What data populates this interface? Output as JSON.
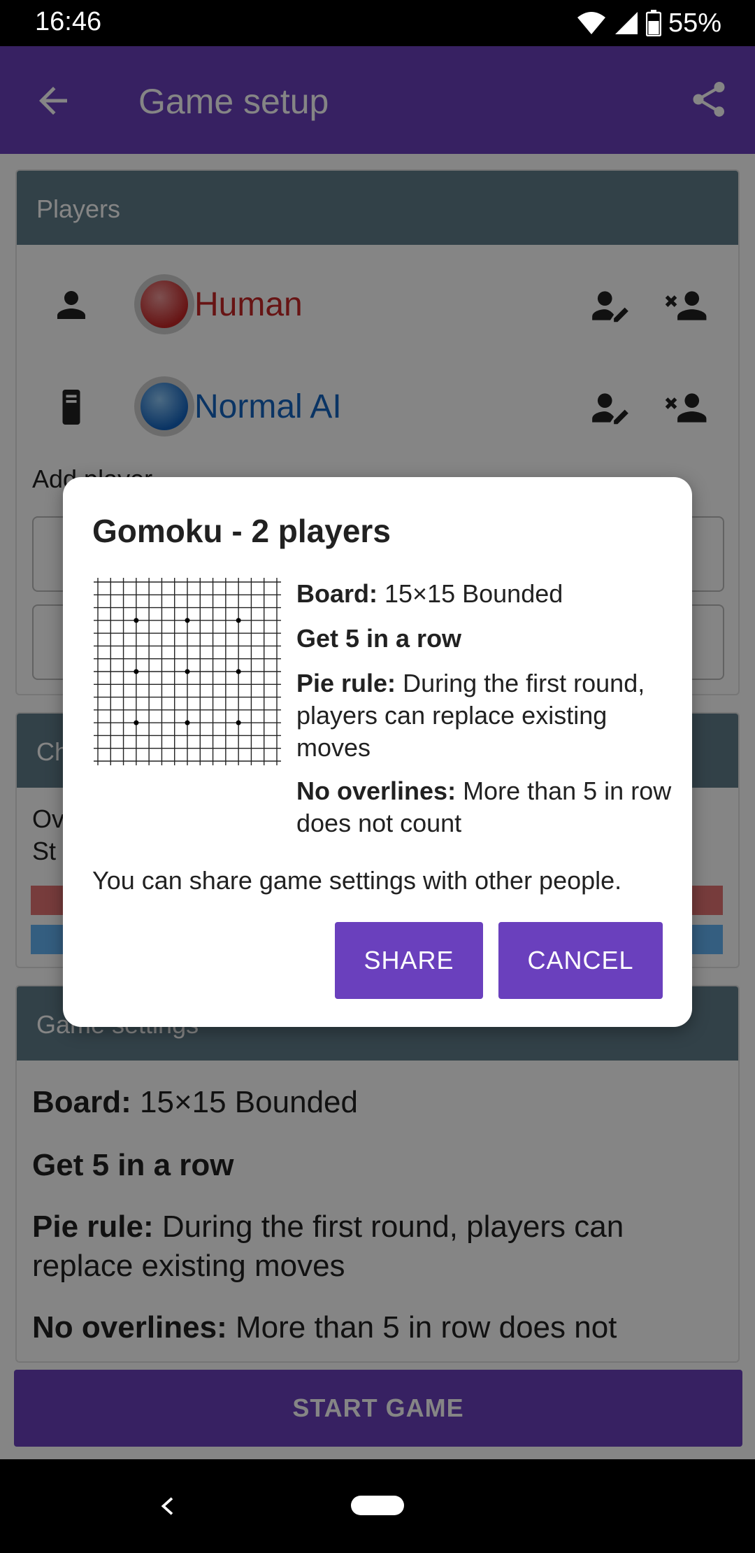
{
  "status_bar": {
    "time": "16:46",
    "battery": "55%"
  },
  "app_bar": {
    "title": "Game setup"
  },
  "players_card": {
    "header": "Players",
    "players": [
      {
        "name": "Human",
        "color": "#c62828",
        "type": "person"
      },
      {
        "name": "Normal AI",
        "color": "#1565c0",
        "type": "computer"
      }
    ],
    "add_label": "Add player"
  },
  "chips_card": {
    "header": "Ch",
    "line1": "Ov",
    "line2": "St"
  },
  "game_card": {
    "header": "Game settings",
    "board_label": "Board:",
    "board_value": " 15×15 Bounded",
    "get_five": "Get 5 in a row",
    "pie_label": "Pie rule:",
    "pie_value": " During the first round, players can replace existing moves",
    "overlines_label": "No overlines:",
    "overlines_value": " More than 5 in row does not"
  },
  "start_button": "START GAME",
  "dialog": {
    "title": "Gomoku - 2 players",
    "board_label": "Board:",
    "board_value": " 15×15 Bounded",
    "get_five": "Get 5 in a row",
    "pie_label": "Pie rule:",
    "pie_value": " During the first round, players can replace existing moves",
    "overlines_label": "No overlines:",
    "overlines_value": " More than 5 in row does not count",
    "share_text": "You can share game settings with other people.",
    "share_button": "SHARE",
    "cancel_button": "CANCEL"
  },
  "colors": {
    "primary": "#6a40bd",
    "card_header": "#607d8b"
  }
}
